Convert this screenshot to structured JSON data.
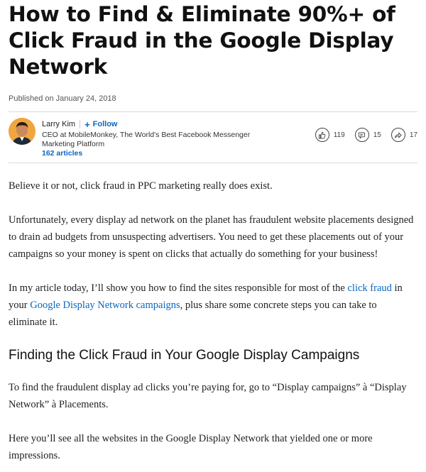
{
  "article": {
    "title": "How to Find & Eliminate 90%+ of Click Fraud in the Google Display Network",
    "published": "Published on January 24, 2018"
  },
  "author": {
    "name": "Larry Kim",
    "follow_label": "Follow",
    "headline": "CEO at MobileMonkey, The World's Best Facebook Messenger Marketing Platform",
    "articles": "162 articles"
  },
  "social": {
    "likes": "119",
    "comments": "15",
    "shares": "17"
  },
  "body": {
    "p1": "Believe it or not, click fraud in PPC marketing really does exist.",
    "p2": "Unfortunately, every display ad network on the planet has fraudulent website placements designed to drain ad budgets from unsuspecting advertisers. You need to get these placements out of your campaigns so your money is spent on clicks that actually do something for your business!",
    "p3_a": "In my article today, I’ll show you how to find the sites responsible for most of the ",
    "p3_link1": "click fraud",
    "p3_b": " in your ",
    "p3_link2": "Google Display Network campaigns",
    "p3_c": ", plus share some concrete steps you can take to eliminate it.",
    "h2": "Finding the Click Fraud in Your Google Display Campaigns",
    "p4": "To find the fraudulent display ad clicks you’re paying for, go to “Display campaigns” à “Display Network” à Placements.",
    "p5": "Here you’ll see all the websites in the Google Display Network that yielded one or more impressions."
  }
}
